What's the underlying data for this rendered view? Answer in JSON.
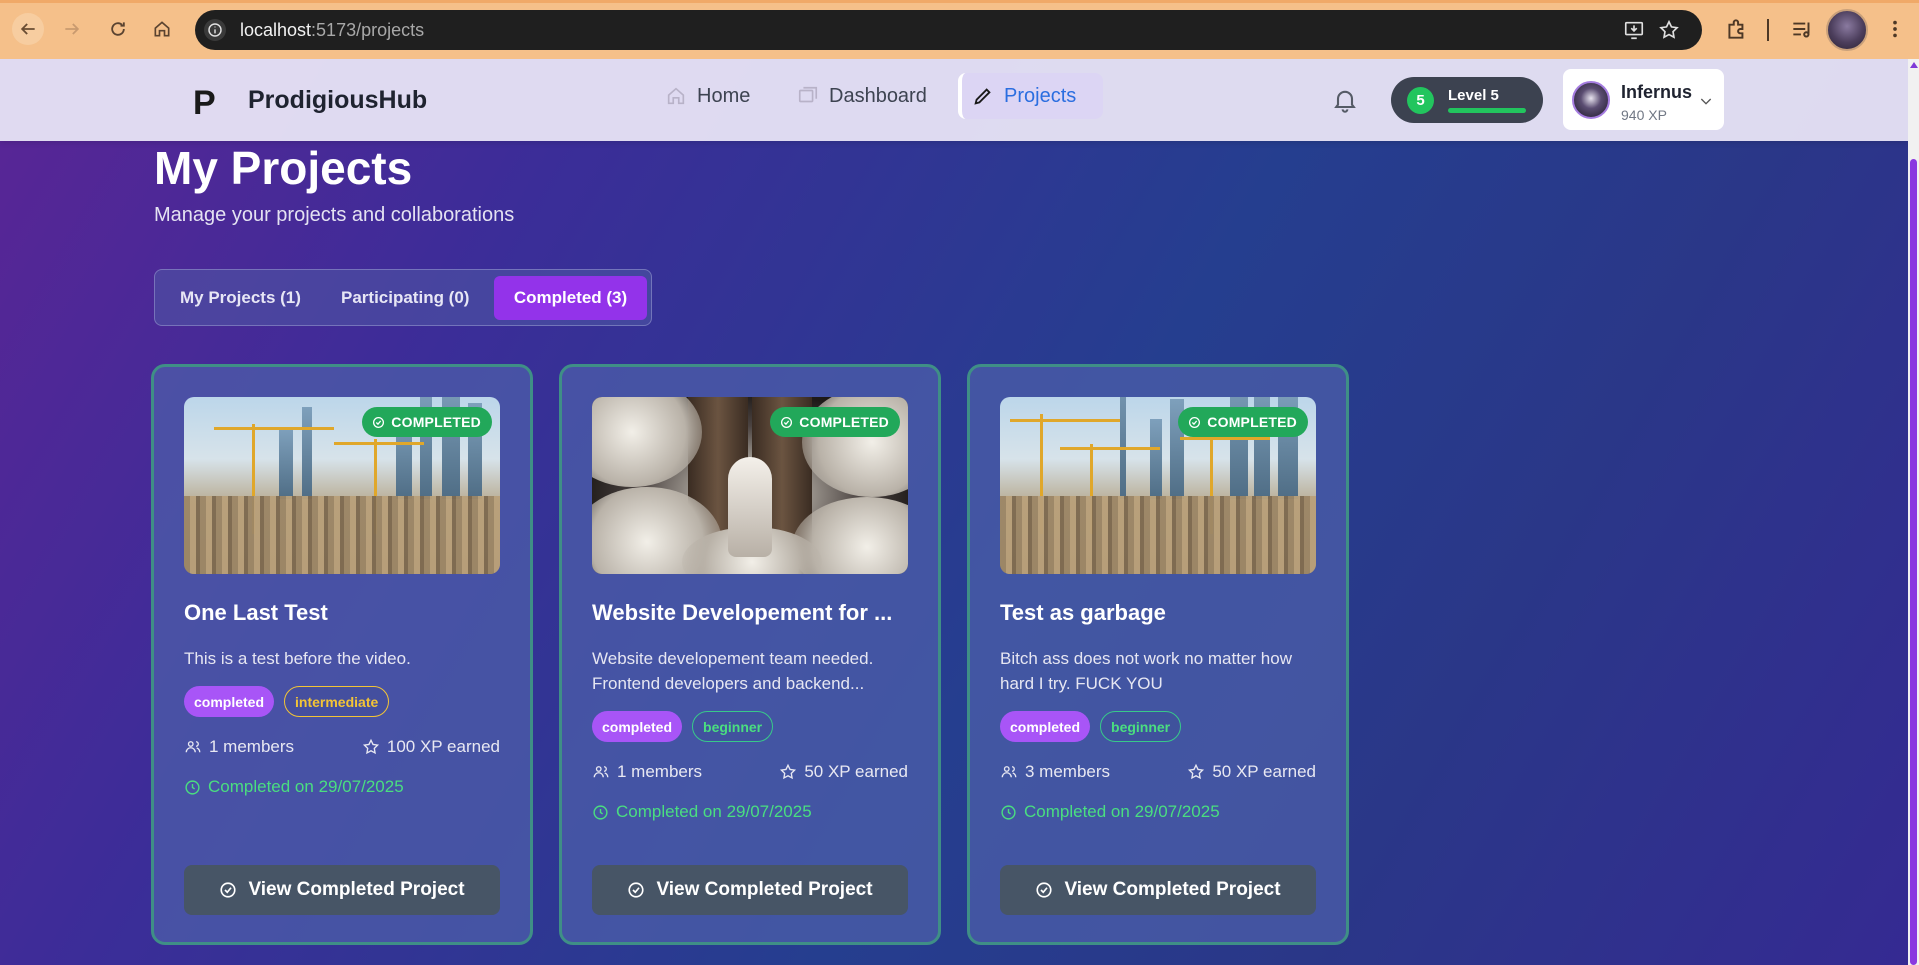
{
  "browser": {
    "url_host": "localhost",
    "url_path": ":5173/projects"
  },
  "header": {
    "brand": "ProdigiousHub",
    "logo_glyph": "P",
    "nav": [
      {
        "label": "Home",
        "icon": "home-icon"
      },
      {
        "label": "Dashboard",
        "icon": "dashboard-icon"
      },
      {
        "label": "Projects",
        "icon": "pencil-icon",
        "active": true
      }
    ],
    "level": {
      "number": "5",
      "label": "Level 5",
      "progress": 1.0,
      "color": "#22c55e"
    },
    "user": {
      "name": "Infernus",
      "xp": "940 XP"
    }
  },
  "main": {
    "title": "My Projects",
    "subtitle": "Manage your projects and collaborations",
    "tabs": [
      {
        "label": "My Projects (1)"
      },
      {
        "label": "Participating (0)"
      },
      {
        "label": "Completed (3)",
        "active": true
      }
    ],
    "cards": [
      {
        "badge": "COMPLETED",
        "title": "One Last Test",
        "description": "This is a test before the video.",
        "status": "completed",
        "difficulty": "intermediate",
        "members": "1 members",
        "xp": "100 XP earned",
        "completed": "Completed on 29/07/2025",
        "button": "View Completed Project"
      },
      {
        "badge": "COMPLETED",
        "title": "Website Developement for ...",
        "description": "Website developement team needed. Frontend developers and backend...",
        "status": "completed",
        "difficulty": "beginner",
        "members": "1 members",
        "xp": "50 XP earned",
        "completed": "Completed on 29/07/2025",
        "button": "View Completed Project"
      },
      {
        "badge": "COMPLETED",
        "title": "Test as garbage",
        "description": "Bitch ass does not work no matter how hard I try. FUCK YOU",
        "status": "completed",
        "difficulty": "beginner",
        "members": "3 members",
        "xp": "50 XP earned",
        "completed": "Completed on 29/07/2025",
        "button": "View Completed Project"
      }
    ]
  },
  "colors": {
    "accent": "#9333ea",
    "completed_green": "#22a85a",
    "intermediate": "#f3c436",
    "beginner": "#4ade80"
  }
}
